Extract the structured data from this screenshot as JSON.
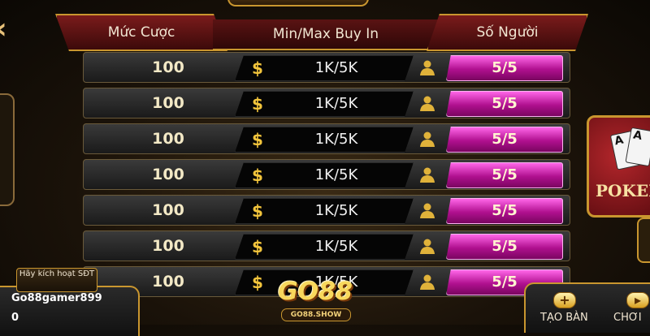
{
  "header": {
    "bet_label": "Mức Cược",
    "buyin_label": "Min/Max Buy In",
    "players_label": "Số Người"
  },
  "rows": [
    {
      "bet": "100",
      "buyin": "1K/5K",
      "players": "5/5"
    },
    {
      "bet": "100",
      "buyin": "1K/5K",
      "players": "5/5"
    },
    {
      "bet": "100",
      "buyin": "1K/5K",
      "players": "5/5"
    },
    {
      "bet": "100",
      "buyin": "1K/5K",
      "players": "5/5"
    },
    {
      "bet": "100",
      "buyin": "1K/5K",
      "players": "5/5"
    },
    {
      "bet": "100",
      "buyin": "1K/5K",
      "players": "5/5"
    },
    {
      "bet": "100",
      "buyin": "1K/5K",
      "players": "5/5"
    }
  ],
  "currency_symbol": "$",
  "account": {
    "activate_label": "Hãy kích hoạt SĐT",
    "username": "Go88gamer899",
    "balance": "0"
  },
  "logo": {
    "main": "GO88",
    "sub": "GO88.SHOW"
  },
  "side_banner": {
    "label": "POKER"
  },
  "bottom_buttons": {
    "create_label": "TẠO BÀN",
    "play_label": "CHƠI"
  },
  "back_icon": "chevron-left-icon",
  "colors": {
    "gold": "#c9962f",
    "header_red": "#7a1b1b",
    "players_pink": "#d21aa8",
    "dollar_yellow": "#f3c53c"
  }
}
